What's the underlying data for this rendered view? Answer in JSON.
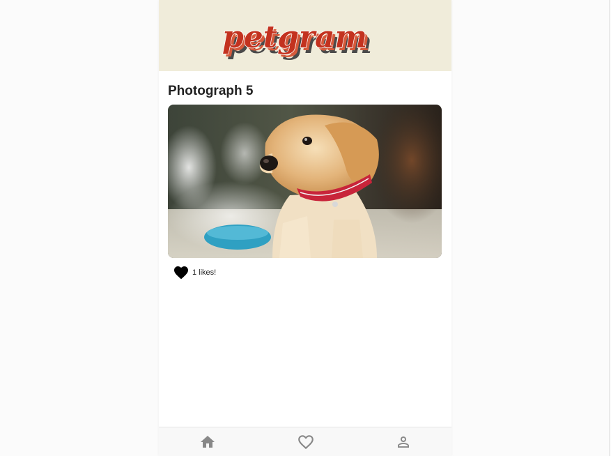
{
  "header": {
    "logo_text": "petgram"
  },
  "photo": {
    "title": "Photograph 5",
    "alt": "Golden retriever puppy with a red collar beside a blue bowl",
    "likes_text": "1 likes!",
    "liked": true
  },
  "navbar": {
    "items": [
      {
        "icon": "home-icon",
        "label": "Home"
      },
      {
        "icon": "heart-outline-icon",
        "label": "Favorites"
      },
      {
        "icon": "user-icon",
        "label": "Profile"
      }
    ]
  },
  "colors": {
    "header_bg": "#f0ecda",
    "logo_red": "#c3321f",
    "logo_shadow": "#4a4a4a",
    "icon_gray": "#888888",
    "text_dark": "#222222"
  }
}
